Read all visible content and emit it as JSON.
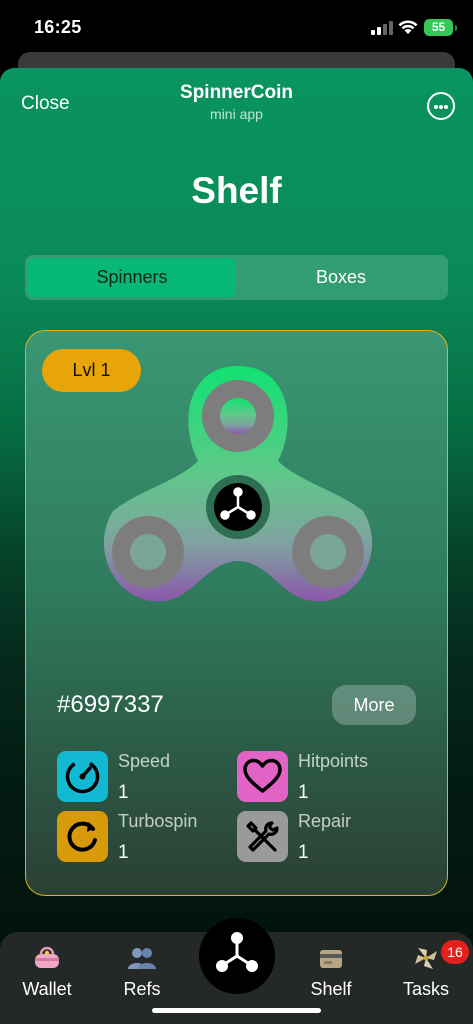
{
  "status": {
    "time": "16:25",
    "battery": "55"
  },
  "header": {
    "close_label": "Close",
    "title": "SpinnerCoin",
    "subtitle": "mini app"
  },
  "page": {
    "title": "Shelf"
  },
  "tabs": [
    {
      "label": "Spinners",
      "active": true
    },
    {
      "label": "Boxes",
      "active": false
    }
  ],
  "card": {
    "level": "Lvl 1",
    "id": "#6997337",
    "more_label": "More",
    "stats": [
      {
        "label": "Speed",
        "value": "1",
        "icon": "speedometer-icon",
        "color": "#13b9d3"
      },
      {
        "label": "Hitpoints",
        "value": "1",
        "icon": "heart-icon",
        "color": "#e163c5"
      },
      {
        "label": "Turbospin",
        "value": "1",
        "icon": "refresh-icon",
        "color": "#d79a0b"
      },
      {
        "label": "Repair",
        "value": "1",
        "icon": "tools-icon",
        "color": "#9a9a9a"
      }
    ],
    "accent": "#d9b323"
  },
  "nav": [
    {
      "label": "Wallet",
      "icon": "purse-icon"
    },
    {
      "label": "Refs",
      "icon": "people-icon"
    },
    {
      "label": "Shelf",
      "icon": "card-box-icon"
    },
    {
      "label": "Tasks",
      "icon": "pinwheel-icon",
      "badge": "16"
    }
  ],
  "colors": {
    "brand": "#099461",
    "segment_active": "#08b878",
    "level_badge": "#e7a50a",
    "badge": "#e5201c"
  }
}
